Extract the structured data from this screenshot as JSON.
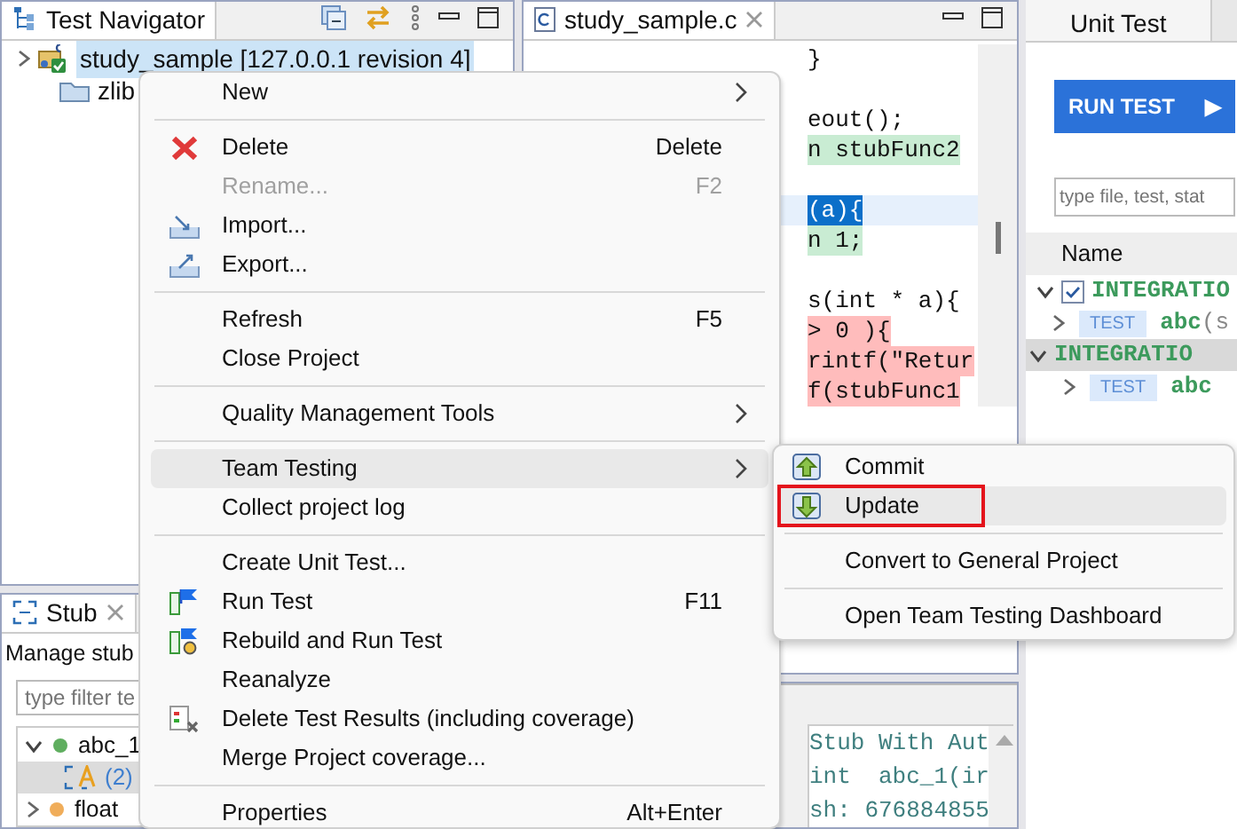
{
  "navigator": {
    "title": "Test Navigator",
    "tree": [
      {
        "kind": "project",
        "label": "study_sample [127.0.0.1 revision 4]",
        "selected": true,
        "expanded": false
      },
      {
        "kind": "folder",
        "label": "zlib",
        "selected": false
      }
    ]
  },
  "editor": {
    "tab": "study_sample.c",
    "lines": [
      {
        "kind": "plain",
        "text": "}"
      },
      {
        "kind": "plain"
      },
      {
        "kind": "plain",
        "text": "eout();"
      },
      {
        "kind": "covered",
        "text": "n stubFunc2"
      },
      {
        "kind": "plain"
      },
      {
        "kind": "current",
        "text": "(a){"
      },
      {
        "kind": "covered",
        "text": "n 1;"
      },
      {
        "kind": "plain"
      },
      {
        "kind": "plain",
        "text": "s(int * a){"
      },
      {
        "kind": "uncovered",
        "text": "> 0 ){"
      },
      {
        "kind": "uncovered",
        "text": "rintf(\"Retur"
      },
      {
        "kind": "uncovered",
        "text": "f(stubFunc1"
      }
    ]
  },
  "unit_test": {
    "tab": "Unit Test",
    "run_button": "RUN TEST",
    "run_glyph": "▶",
    "search": {
      "placeholder": "type file, test, stat"
    },
    "column": "Name",
    "rows": [
      {
        "kind": "group",
        "label": "INTEGRATIO",
        "checked": true,
        "selected": false
      },
      {
        "kind": "test",
        "badge": "TEST",
        "label": "abc",
        "args": "(s",
        "selected": false
      },
      {
        "kind": "group",
        "label": "INTEGRATIO",
        "selected": true
      },
      {
        "kind": "test",
        "badge": "TEST",
        "label": "abc",
        "selected": false
      }
    ]
  },
  "stub": {
    "tab": "Stub",
    "caption": "Manage stub",
    "filter": {
      "placeholder": "type filter te"
    },
    "tree": [
      {
        "label": "abc_1",
        "color": "#5fae5f",
        "expanded": true,
        "selected": false,
        "children": [
          {
            "label": "(2)",
            "selected": true
          }
        ]
      },
      {
        "label": "float",
        "color": "#f0ad5a",
        "expanded": false,
        "selected": false
      }
    ]
  },
  "console": {
    "lines": [
      "Stub With Aut",
      "int  abc_1(ir",
      "sh: 676884855"
    ]
  },
  "context_menu": {
    "items": [
      {
        "kind": "plain",
        "label": "New",
        "submenu": true,
        "disabled": false,
        "selected": false
      },
      {
        "kind": "separator"
      },
      {
        "kind": "delete",
        "label": "Delete",
        "shortcut": "Delete",
        "disabled": false,
        "selected": false
      },
      {
        "kind": "plain",
        "label": "Rename...",
        "shortcut": "F2",
        "disabled": true,
        "selected": false
      },
      {
        "kind": "import",
        "label": "Import...",
        "disabled": false,
        "selected": false
      },
      {
        "kind": "export",
        "label": "Export...",
        "disabled": false,
        "selected": false
      },
      {
        "kind": "separator"
      },
      {
        "kind": "plain",
        "label": "Refresh",
        "shortcut": "F5",
        "disabled": false,
        "selected": false
      },
      {
        "kind": "plain",
        "label": "Close Project",
        "disabled": false,
        "selected": false
      },
      {
        "kind": "separator"
      },
      {
        "kind": "plain",
        "label": "Quality Management Tools",
        "submenu": true,
        "disabled": false,
        "selected": false
      },
      {
        "kind": "separator"
      },
      {
        "kind": "plain",
        "label": "Team Testing",
        "submenu": true,
        "disabled": false,
        "selected": true
      },
      {
        "kind": "plain",
        "label": "Collect project log",
        "disabled": false,
        "selected": false
      },
      {
        "kind": "separator"
      },
      {
        "kind": "plain",
        "label": "Create Unit Test...",
        "disabled": false,
        "selected": false
      },
      {
        "kind": "run",
        "label": "Run Test",
        "shortcut": "F11",
        "disabled": false,
        "selected": false
      },
      {
        "kind": "rebuild",
        "label": "Rebuild and Run Test",
        "disabled": false,
        "selected": false
      },
      {
        "kind": "plain",
        "label": "Reanalyze",
        "disabled": false,
        "selected": false
      },
      {
        "kind": "clear",
        "label": "Delete Test Results (including coverage)",
        "disabled": false,
        "selected": false
      },
      {
        "kind": "plain",
        "label": "Merge Project coverage...",
        "disabled": false,
        "selected": false
      },
      {
        "kind": "separator"
      },
      {
        "kind": "plain",
        "label": "Properties",
        "shortcut": "Alt+Enter",
        "disabled": false,
        "selected": false
      }
    ]
  },
  "submenu": {
    "items": [
      {
        "kind": "commit",
        "label": "Commit",
        "selected": false,
        "outlined": false
      },
      {
        "kind": "update",
        "label": "Update",
        "selected": true,
        "outlined": true
      },
      {
        "kind": "separator"
      },
      {
        "kind": "plain",
        "label": "Convert to General Project",
        "selected": false,
        "outlined": false
      },
      {
        "kind": "separator"
      },
      {
        "kind": "plain",
        "label": "Open Team Testing Dashboard",
        "selected": false,
        "outlined": false
      }
    ]
  }
}
